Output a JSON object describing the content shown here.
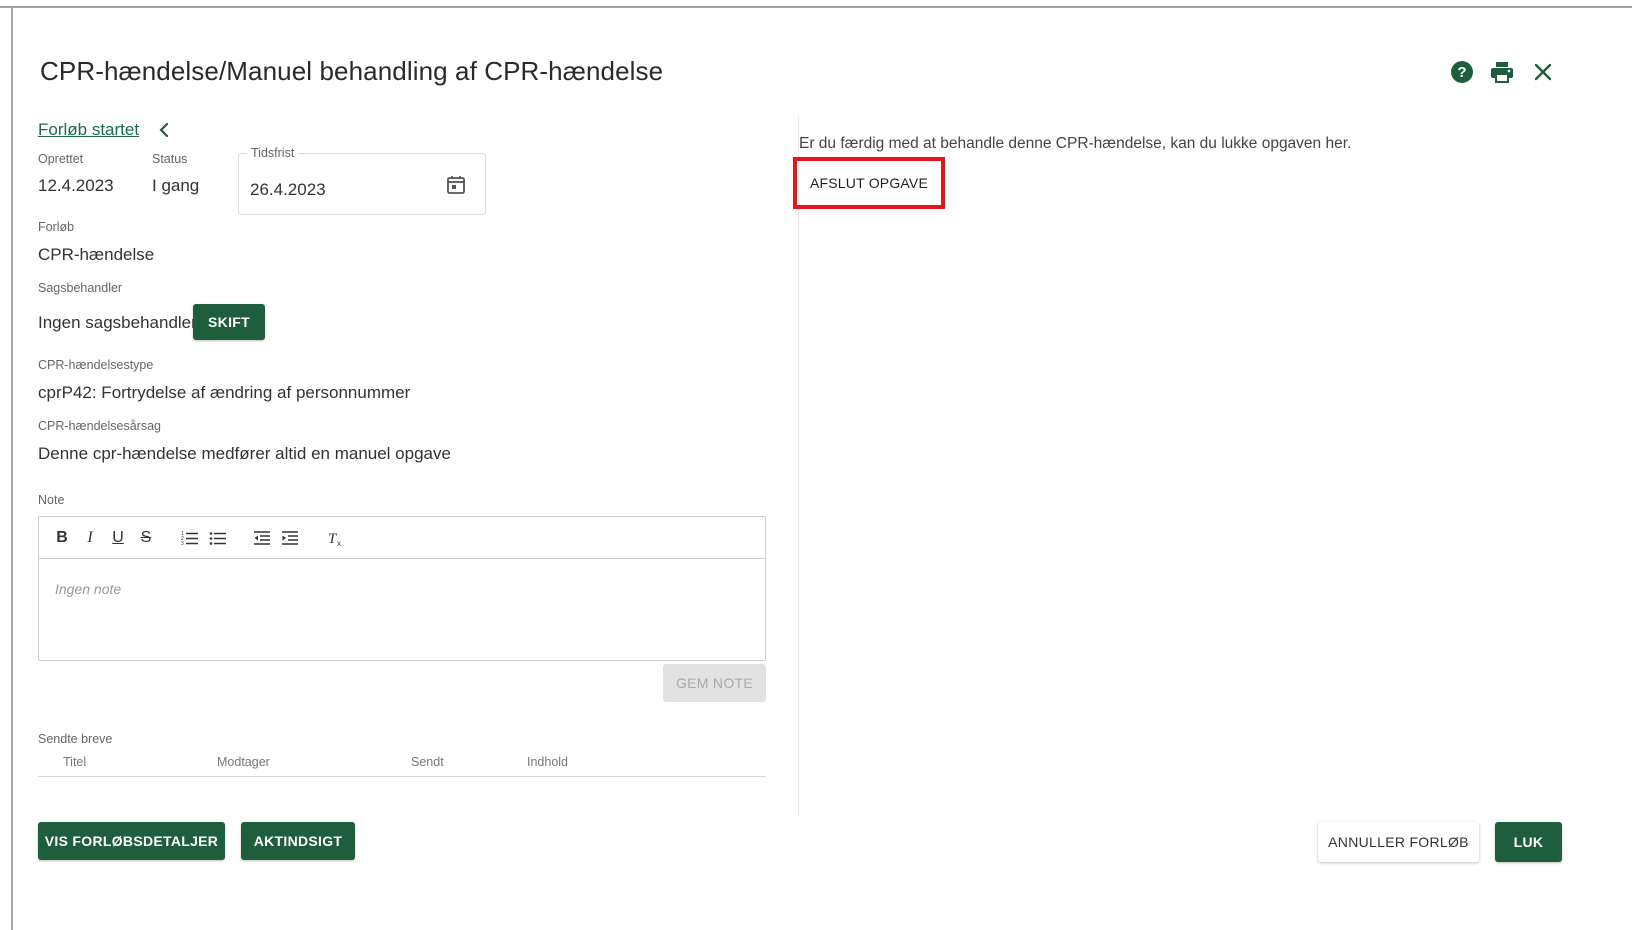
{
  "header": {
    "title": "CPR-hændelse/Manuel behandling af CPR-hændelse",
    "icons": [
      "help-icon",
      "print-icon",
      "close-icon"
    ]
  },
  "status_link": "Forløb startet",
  "fields": {
    "oprettet_label": "Oprettet",
    "oprettet_value": "12.4.2023",
    "status_label": "Status",
    "status_value": "I gang",
    "tidsfrist_label": "Tidsfrist",
    "tidsfrist_value": "26.4.2023",
    "forloeb_label": "Forløb",
    "forloeb_value": "CPR-hændelse",
    "sagsbehandler_label": "Sagsbehandler",
    "sagsbehandler_value": "Ingen sagsbehandler",
    "skift_label": "SKIFT",
    "type_label": "CPR-hændelsestype",
    "type_value": "cprP42: Fortrydelse af ændring af personnummer",
    "aarsag_label": "CPR-hændelsesårsag",
    "aarsag_value": "Denne cpr-hændelse medfører altid en manuel opgave"
  },
  "note": {
    "label": "Note",
    "placeholder": "Ingen note",
    "save_label": "GEM NOTE",
    "toolbar": [
      "B",
      "I",
      "U",
      "S"
    ]
  },
  "letters": {
    "label": "Sendte breve",
    "columns": [
      "Titel",
      "Modtager",
      "Sendt",
      "Indhold"
    ]
  },
  "right": {
    "info": "Er du færdig med at behandle denne CPR-hændelse, kan du lukke opgaven her.",
    "afslut_label": "AFSLUT OPGAVE"
  },
  "footer": {
    "vis_label": "VIS FORLØBSDETALJER",
    "aktindsigt_label": "AKTINDSIGT",
    "annuller_label": "ANNULLER FORLØB",
    "luk_label": "LUK"
  },
  "colors": {
    "primary_green": "#1e5e3c",
    "link_green": "#1a6b48",
    "highlight_red": "#e8141b"
  }
}
